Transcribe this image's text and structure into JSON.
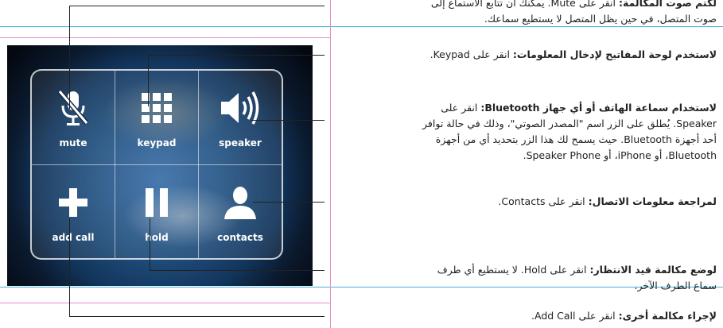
{
  "buttons": {
    "mute": "mute",
    "keypad": "keypad",
    "speaker": "speaker",
    "add_call": "add call",
    "hold": "hold",
    "contacts": "contacts"
  },
  "callouts": {
    "mute": {
      "title": "لكتم صوت المكالمة:",
      "lines": [
        "انقر على Mute. يمكنك أن تتابع الاستماع إلى",
        "صوت المتصل، في حين يظل المتصل لا يستطيع سماعك."
      ]
    },
    "keypad": {
      "title": "لاستخدم لوحة المفاتيح لإدخال المعلومات:",
      "lines": [
        "انقر على Keypad."
      ]
    },
    "speaker": {
      "title": "لاستخدام سماعة الهاتف أو أي جهاز Bluetooth:",
      "lines": [
        "انقر على",
        "Speaker. يُطلق على الزر اسم \"المصدر الصوتي\"، وذلك في حالة توافر",
        "أحد أجهزة Bluetooth. حيث يسمح لك هذا الزر بتحديد أي من أجهزة",
        "Bluetooth، أو iPhone، أو Speaker Phone."
      ]
    },
    "contacts": {
      "title": "لمراجعة معلومات الاتصال:",
      "lines": [
        "انقر على Contacts."
      ]
    },
    "hold": {
      "title": "لوضع مكالمة قيد الانتظار:",
      "lines": [
        "انقر على Hold. لا يستطيع أي طرف",
        "سماع الطرف الآخر."
      ]
    },
    "add_call": {
      "title": "لإجراء مكالمة أخرى:",
      "lines": [
        "انقر على Add Call."
      ]
    }
  }
}
